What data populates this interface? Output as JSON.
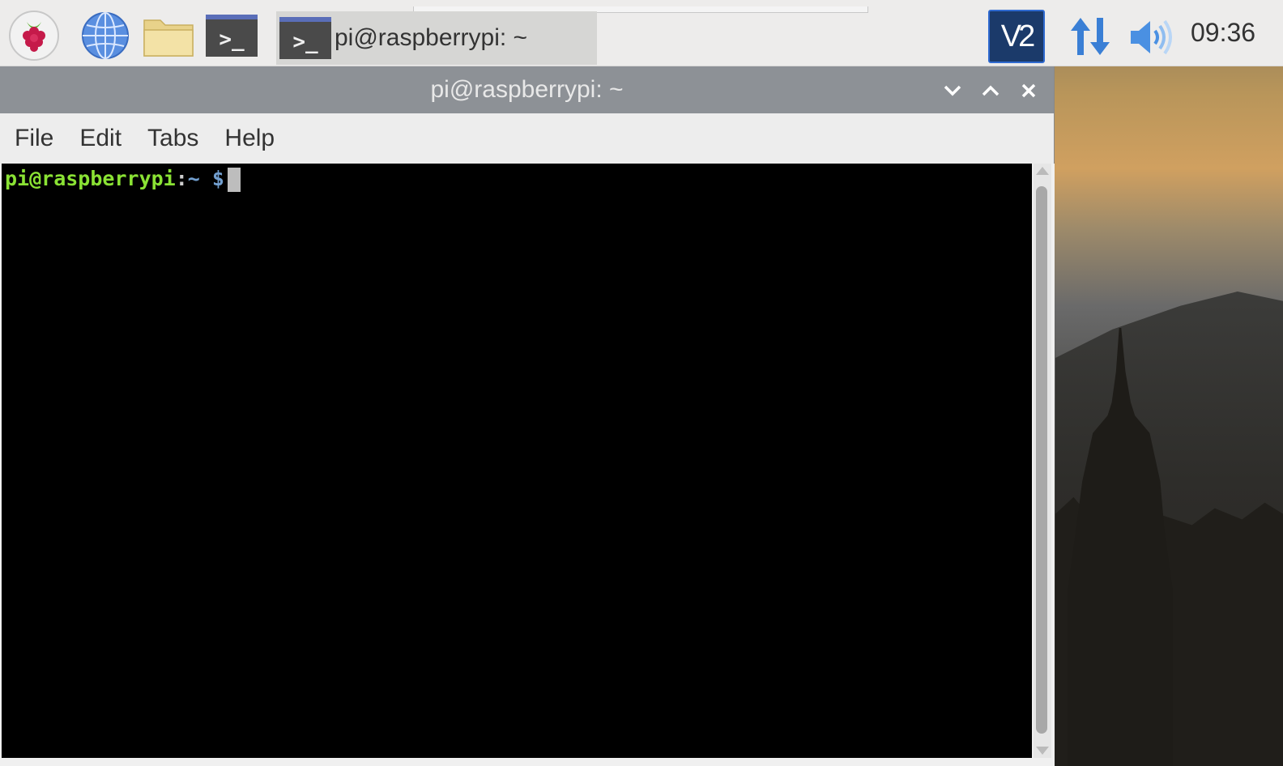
{
  "panel": {
    "launchers": [
      {
        "name": "raspberry-menu-icon"
      },
      {
        "name": "globe-browser-icon"
      },
      {
        "name": "folder-icon"
      },
      {
        "name": "terminal-icon",
        "glyph": ">_"
      }
    ],
    "taskbar_item": {
      "glyph": ">_",
      "label": "pi@raspberrypi: ~"
    },
    "tray": {
      "vnc_label": "V2",
      "network_icon": "network-updown-icon",
      "volume_icon": "speaker-icon"
    },
    "clock": "09:36"
  },
  "window": {
    "title": "pi@raspberrypi: ~",
    "controls": {
      "minimize": "⌄",
      "maximize": "⌃",
      "close": "✕"
    },
    "menu": [
      "File",
      "Edit",
      "Tabs",
      "Help"
    ],
    "terminal": {
      "user_host": "pi@raspberrypi",
      "colon": ":",
      "path": "~",
      "dollar": " $",
      "colors": {
        "user": "#8ae234",
        "path": "#729fcf",
        "background": "#000000"
      }
    }
  },
  "colors": {
    "titlebar": "#8d9196",
    "panel": "#edeceb",
    "vnc_tray": "#1b3a6a"
  }
}
